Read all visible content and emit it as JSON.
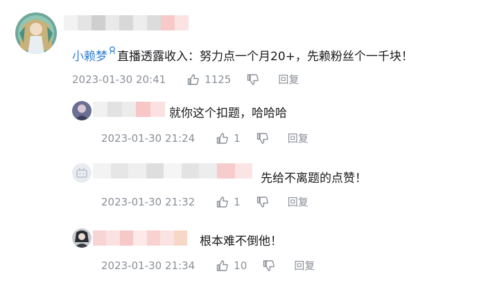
{
  "icons": {
    "like": "thumbs-up-icon",
    "dislike": "thumbs-down-icon",
    "level_badge": "up-badge-icon"
  },
  "colors": {
    "username": "#2f7fd1",
    "meta": "#8a8f97",
    "text": "#18191c"
  },
  "main_comment": {
    "username": "小赖梦",
    "content": "直播透露收入：努力点一个月20+，先赖粉丝个一千块！",
    "time": "2023-01-30 20:41",
    "likes": "1125",
    "reply_label": "回复"
  },
  "replies": [
    {
      "content": "就你这个扣题，哈哈哈",
      "time": "2023-01-30 21:24",
      "likes": "1",
      "reply_label": "回复"
    },
    {
      "content": "先给不离题的点赞！",
      "time": "2023-01-30 21:32",
      "likes": "1",
      "reply_label": "回复"
    },
    {
      "content": "根本难不倒他！",
      "time": "2023-01-30 21:34",
      "likes": "10",
      "reply_label": "回复"
    }
  ]
}
